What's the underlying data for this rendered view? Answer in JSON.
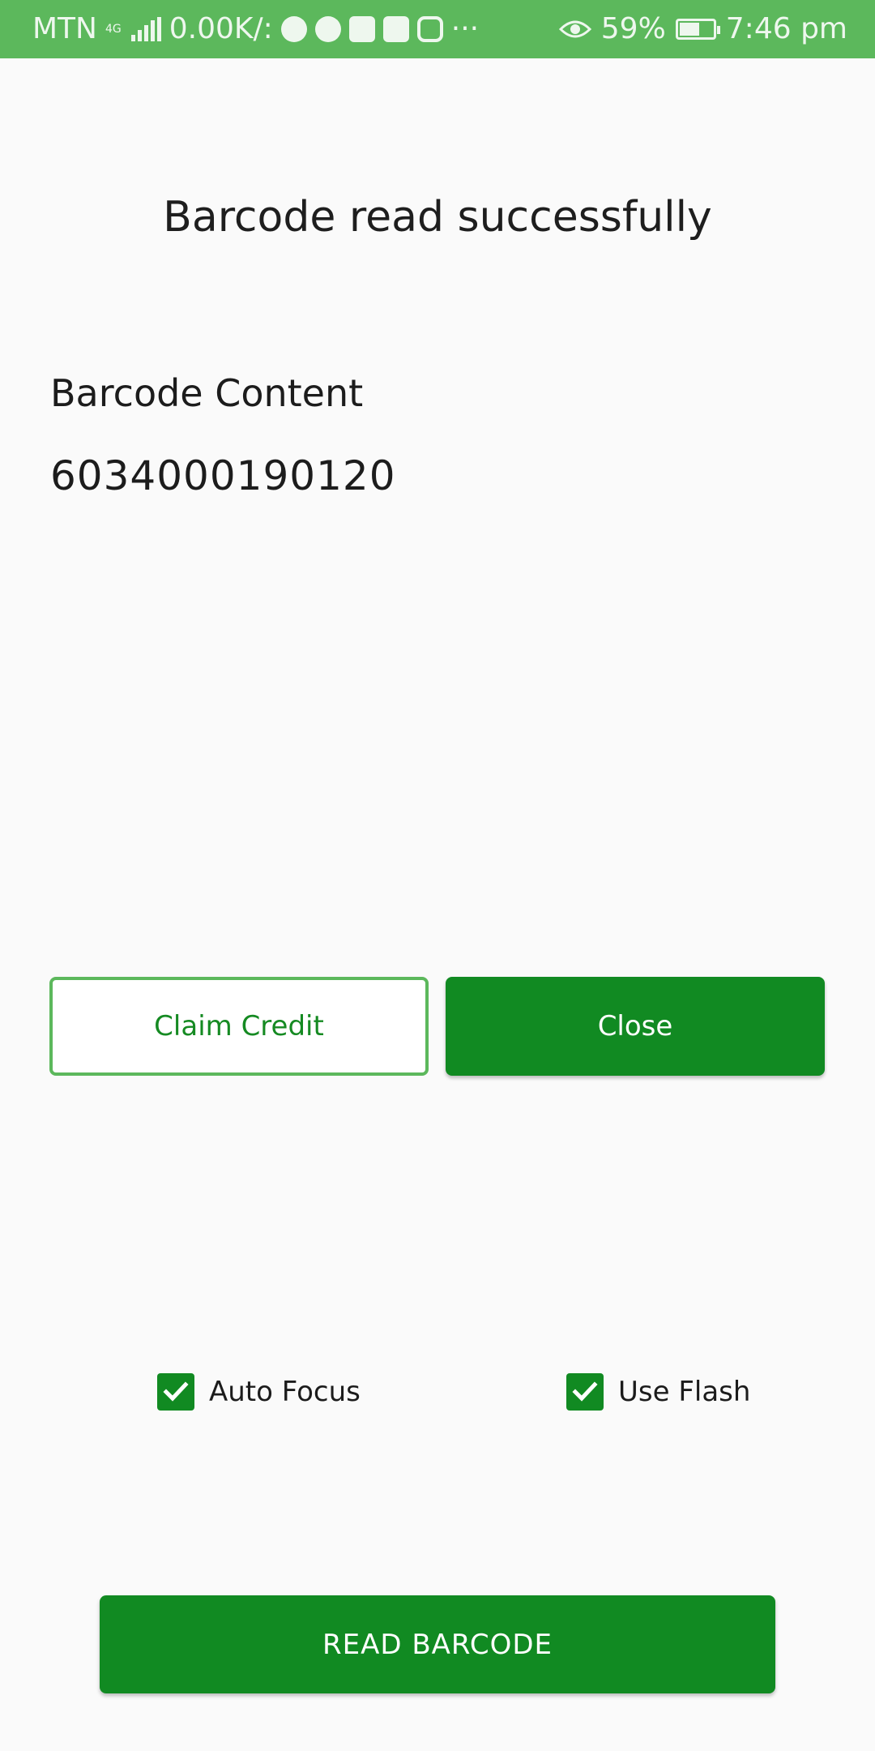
{
  "status_bar": {
    "carrier": "MTN",
    "network_type": "4G",
    "speed": "0.00K/:",
    "battery_percent": "59%",
    "time": "7:46 pm",
    "notification_icons": [
      "whatsapp-icon",
      "telegram-icon",
      "outlook-icon",
      "linkedin-icon",
      "instagram-icon"
    ],
    "overflow": "···",
    "color": "#5cb85c"
  },
  "screen": {
    "title": "Barcode read successfully",
    "content_label": "Barcode Content",
    "content_value": "6034000190120"
  },
  "buttons": {
    "claim_credit": "Claim Credit",
    "close": "Close",
    "read_barcode": "READ BARCODE"
  },
  "options": {
    "auto_focus": {
      "label": "Auto Focus",
      "checked": true
    },
    "use_flash": {
      "label": "Use Flash",
      "checked": true
    }
  },
  "colors": {
    "accent": "#118a22",
    "outline": "#5cb85c",
    "background": "#fafafa"
  }
}
